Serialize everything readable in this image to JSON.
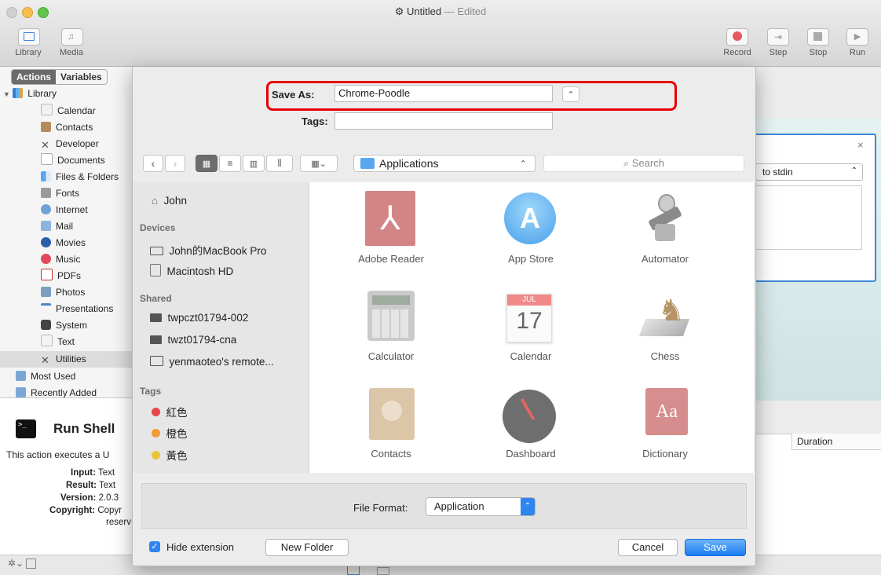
{
  "window": {
    "title": "Untitled",
    "status": "Edited"
  },
  "toolbar": {
    "left": [
      {
        "label": "Library"
      },
      {
        "label": "Media"
      }
    ],
    "right": [
      {
        "label": "Record"
      },
      {
        "label": "Step"
      },
      {
        "label": "Stop"
      },
      {
        "label": "Run"
      }
    ]
  },
  "library_tabs": [
    "Actions",
    "Variables"
  ],
  "library": {
    "root": "Library",
    "items": [
      "Calendar",
      "Contacts",
      "Developer",
      "Documents",
      "Files & Folders",
      "Fonts",
      "Internet",
      "Mail",
      "Movies",
      "Music",
      "PDFs",
      "Photos",
      "Presentations",
      "System",
      "Text",
      "Utilities"
    ],
    "selected": "Utilities",
    "extra": [
      "Most Used",
      "Recently Added"
    ]
  },
  "action_info": {
    "title": "Run Shell",
    "description": "This action executes a U",
    "fields": [
      {
        "label": "Input:",
        "value": "Text"
      },
      {
        "label": "Result:",
        "value": "Text"
      },
      {
        "label": "Version:",
        "value": "2.0.3"
      },
      {
        "label": "Copyright:",
        "value": "Copyr"
      }
    ],
    "copyright_more": "reserv"
  },
  "workflow": {
    "pass_input": "to stdin",
    "close": "×",
    "log_column": "Duration"
  },
  "save_sheet": {
    "save_as_label": "Save As:",
    "save_as_value": "Chrome-Poodle",
    "tags_label": "Tags:",
    "tags_value": "",
    "location": "Applications",
    "search_placeholder": "Search",
    "sidebar": {
      "favorites": [
        "John"
      ],
      "devices_header": "Devices",
      "devices": [
        "John的MacBook Pro",
        "Macintosh HD"
      ],
      "shared_header": "Shared",
      "shared": [
        "twpczt01794-002",
        "twzt01794-cna",
        "yenmaoteo's remote..."
      ],
      "tags_header": "Tags",
      "tags": [
        {
          "name": "紅色",
          "color": "#e8464a"
        },
        {
          "name": "橙色",
          "color": "#f29b38"
        },
        {
          "name": "黃色",
          "color": "#e9c33a"
        }
      ]
    },
    "files": [
      {
        "name": "Adobe Reader",
        "icon": "adobe-reader-icon"
      },
      {
        "name": "App Store",
        "icon": "app-store-icon"
      },
      {
        "name": "Automator",
        "icon": "automator-icon"
      },
      {
        "name": "Calculator",
        "icon": "calculator-icon"
      },
      {
        "name": "Calendar",
        "icon": "calendar-icon"
      },
      {
        "name": "Chess",
        "icon": "chess-icon"
      },
      {
        "name": "Contacts",
        "icon": "contacts-icon"
      },
      {
        "name": "Dashboard",
        "icon": "dashboard-icon"
      },
      {
        "name": "Dictionary",
        "icon": "dictionary-icon"
      }
    ],
    "calendar_icon": {
      "month": "JUL",
      "day": "17"
    },
    "dictionary_icon": {
      "text": "Aa"
    },
    "file_format_label": "File Format:",
    "file_format_value": "Application",
    "hide_extension_label": "Hide extension",
    "hide_extension_checked": true,
    "new_folder_label": "New Folder",
    "cancel_label": "Cancel",
    "save_label": "Save"
  },
  "colors": {
    "accent": "#1b7bf0",
    "highlight_box": "#e60000"
  }
}
